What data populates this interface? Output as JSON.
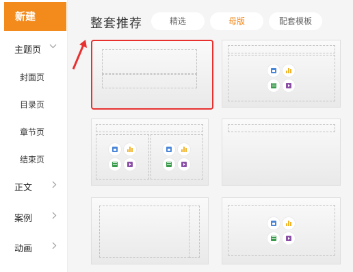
{
  "sidebar": {
    "new_label": "新建",
    "sections": [
      {
        "label": "主题页",
        "chevron": "chevron-down"
      },
      {
        "label": "正文",
        "chevron": "chevron-right"
      },
      {
        "label": "案例",
        "chevron": "chevron-right"
      },
      {
        "label": "动画",
        "chevron": "chevron-right"
      }
    ],
    "sub_items": [
      "封面页",
      "目录页",
      "章节页",
      "结束页"
    ]
  },
  "main": {
    "title": "整套推荐",
    "tabs": [
      {
        "label": "精选",
        "active": false
      },
      {
        "label": "母版",
        "active": true
      },
      {
        "label": "配套模板",
        "active": false
      }
    ],
    "accent_color": "#f28a1c",
    "selection_color": "#e8302f",
    "placeholder_icons": [
      "image-icon",
      "bar-chart-icon",
      "table-icon",
      "video-icon"
    ]
  }
}
